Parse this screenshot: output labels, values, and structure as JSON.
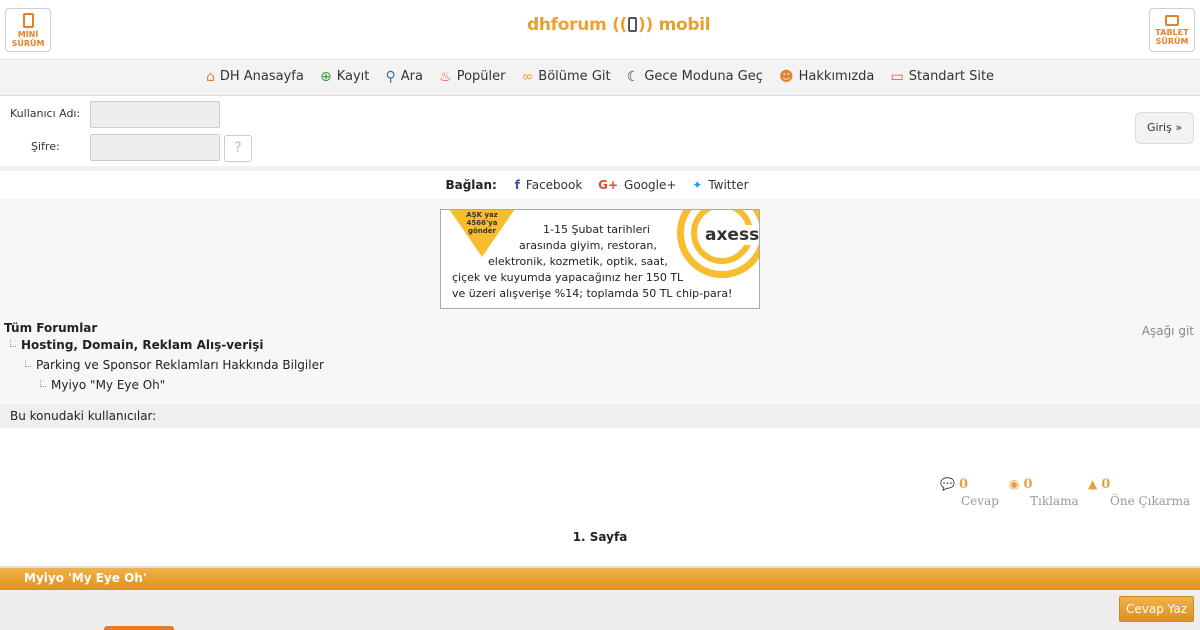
{
  "header": {
    "mini_label_1": "MİNİ",
    "mini_label_2": "SÜRÜM",
    "tablet_label_1": "TABLET",
    "tablet_label_2": "SÜRÜM",
    "logo_dh": "dh",
    "logo_forum": "forum",
    "logo_mobil": "mobil"
  },
  "nav": {
    "items": [
      {
        "label": "DH Anasayfa",
        "icon": "home-icon",
        "color": "#e3822c"
      },
      {
        "label": "Kayıt",
        "icon": "user-plus-icon",
        "color": "#3a9a3a"
      },
      {
        "label": "Ara",
        "icon": "search-icon",
        "color": "#3a6fb0"
      },
      {
        "label": "Popüler",
        "icon": "fire-icon",
        "color": "#e0502c"
      },
      {
        "label": "Bölüme Git",
        "icon": "link-icon",
        "color": "#e8a030"
      },
      {
        "label": "Gece Moduna Geç",
        "icon": "moon-icon",
        "color": "#333333"
      },
      {
        "label": "Hakkımızda",
        "icon": "users-icon",
        "color": "#e3822c"
      },
      {
        "label": "Standart Site",
        "icon": "desktop-icon",
        "color": "#e0502c"
      }
    ]
  },
  "login": {
    "username_label": "Kullanıcı Adı:",
    "password_label": "Şifre:",
    "help": "?",
    "submit": "Giriş »"
  },
  "connect": {
    "title": "Bağlan:",
    "facebook": "Facebook",
    "google": "Google+",
    "twitter": "Twitter"
  },
  "banner": {
    "badge_1": "AŞK yaz",
    "badge_2": "4566'ya",
    "badge_3": "gönder",
    "brand": "axess",
    "line_1": "1-15 Şubat tarihleri",
    "line_2": "arasında giyim, restoran,",
    "line_3": "elektronik, kozmetik, optik, saat,",
    "line_4": "çiçek ve kuyumda yapacağınız her 150 TL",
    "line_5": "ve üzeri alışverişe %14; toplamda 50 TL chip-para!"
  },
  "breadcrumb": {
    "root": "Tüm Forumlar",
    "level1": "Hosting, Domain, Reklam Alış-verişi",
    "level2": "Parking ve Sponsor Reklamları Hakkında Bilgiler",
    "level3": "Myiyo \"My Eye Oh\"",
    "jump_down": "Aşağı git"
  },
  "users": {
    "label": "Bu konudaki kullanıcılar:"
  },
  "stats": {
    "replies": {
      "value": "0",
      "label": "Cevap"
    },
    "clicks": {
      "value": "0",
      "label": "Tıklama"
    },
    "promote": {
      "value": "0",
      "label": "Öne Çıkarma"
    },
    "accent": "#e8a040"
  },
  "page": {
    "label": "1. Sayfa"
  },
  "topic": {
    "title": "Myiyo 'My Eye Oh'",
    "reply_button": "Cevap Yaz"
  }
}
